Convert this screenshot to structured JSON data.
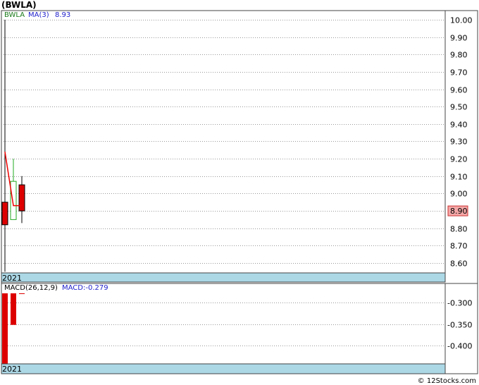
{
  "header": {
    "title": "(BWLA)"
  },
  "footer": {
    "credit": "© 12Stocks.com"
  },
  "colors": {
    "up": "#22aa22",
    "down": "#dd0000",
    "ma": "#ee0000",
    "band": "#acd8e6",
    "grid": "#999999",
    "last_price_box": "#f4a7a7"
  },
  "chart_data": [
    {
      "type": "candlestick",
      "legend": {
        "symbol": "BWLA",
        "ma_label": "MA(3)",
        "ma_value": "8.93"
      },
      "ylim": [
        8.53,
        10.05
      ],
      "yticks": [
        8.6,
        8.7,
        8.8,
        8.9,
        9.0,
        9.1,
        9.2,
        9.3,
        9.4,
        9.5,
        9.6,
        9.7,
        9.8,
        9.9,
        10.0
      ],
      "ytick_labels": [
        "8.60",
        "8.70",
        "8.80",
        "8.90",
        "9.00",
        "9.10",
        "9.20",
        "9.30",
        "9.40",
        "9.50",
        "9.60",
        "9.70",
        "9.80",
        "9.90",
        "10.00"
      ],
      "last_price": "8.90",
      "x_label": "2021",
      "candles": [
        {
          "open": 8.95,
          "high": 10.0,
          "low": 8.55,
          "close": 8.82
        },
        {
          "open": 8.85,
          "high": 9.2,
          "low": 8.85,
          "close": 9.07
        },
        {
          "open": 9.05,
          "high": 9.1,
          "low": 8.83,
          "close": 8.9
        }
      ],
      "ma": [
        9.24,
        8.93,
        8.93
      ],
      "grid": true
    },
    {
      "type": "bar",
      "legend": {
        "label": "MACD(26,12,9)",
        "value_label": "MACD:-0.279"
      },
      "ylim": [
        -0.46,
        -0.27
      ],
      "yticks": [
        -0.3,
        -0.35,
        -0.4
      ],
      "ytick_labels": [
        "-0.300",
        "-0.350",
        "-0.400"
      ],
      "x_label": "2021",
      "values": [
        -0.46,
        -0.352,
        -0.279
      ],
      "grid": true
    }
  ]
}
